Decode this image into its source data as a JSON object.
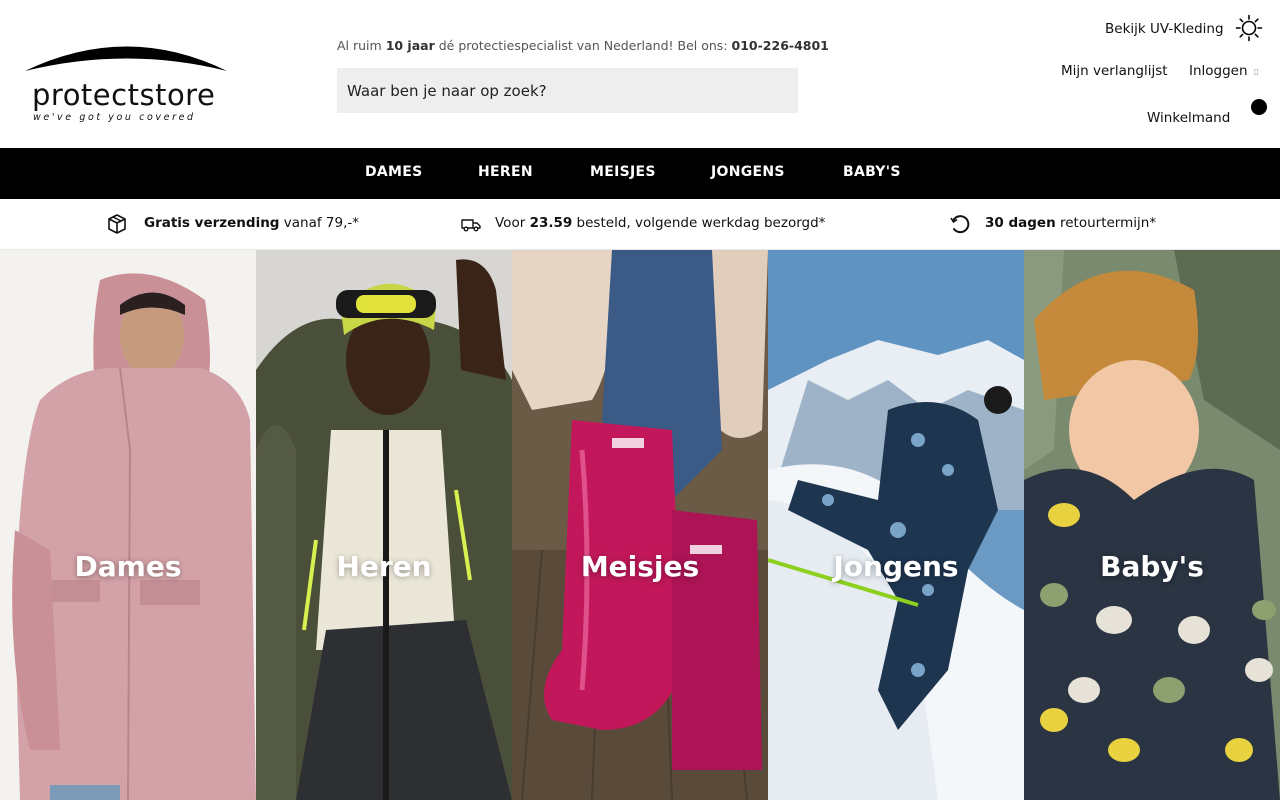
{
  "brand": {
    "name": "protectstore",
    "tagline": "we've got you covered"
  },
  "header": {
    "contact_pre": "Al ruim ",
    "contact_years": "10 jaar",
    "contact_mid": " dé protectiespecialist van Nederland! Bel ons: ",
    "contact_phone": "010-226-4801",
    "search_placeholder": "Waar ben je naar op zoek?",
    "uv_link": "Bekijk UV-Kleding",
    "wishlist": "Mijn verlanglijst",
    "login": "Inloggen",
    "cart": "Winkelmand",
    "icons": {
      "uv": "sun-icon",
      "login": "user-icon",
      "cart": "cart-badge"
    }
  },
  "nav": {
    "items": [
      {
        "label": "DAMES"
      },
      {
        "label": "HEREN"
      },
      {
        "label": "MEISJES"
      },
      {
        "label": "JONGENS"
      },
      {
        "label": "BABY'S"
      }
    ]
  },
  "usp": [
    {
      "bold": "Gratis verzending",
      "rest": " vanaf 79,-*",
      "icon": "package-icon"
    },
    {
      "pre": "Voor ",
      "bold": "23.59",
      "rest": " besteld, volgende werkdag bezorgd*",
      "icon": "truck-icon"
    },
    {
      "bold": "30 dagen",
      "rest": " retourtermijn*",
      "icon": "return-icon"
    }
  ],
  "tiles": [
    {
      "label": "Dames",
      "image": "woman-pink-parka"
    },
    {
      "label": "Heren",
      "image": "man-green-jacket"
    },
    {
      "label": "Meisjes",
      "image": "pink-rain-boots"
    },
    {
      "label": "Jongens",
      "image": "boy-skiing-snow"
    },
    {
      "label": "Baby's",
      "image": "baby-elephant-jacket"
    }
  ],
  "colors": {
    "nav_bg": "#000000",
    "search_bg": "#eeeeee",
    "text": "#111111"
  }
}
